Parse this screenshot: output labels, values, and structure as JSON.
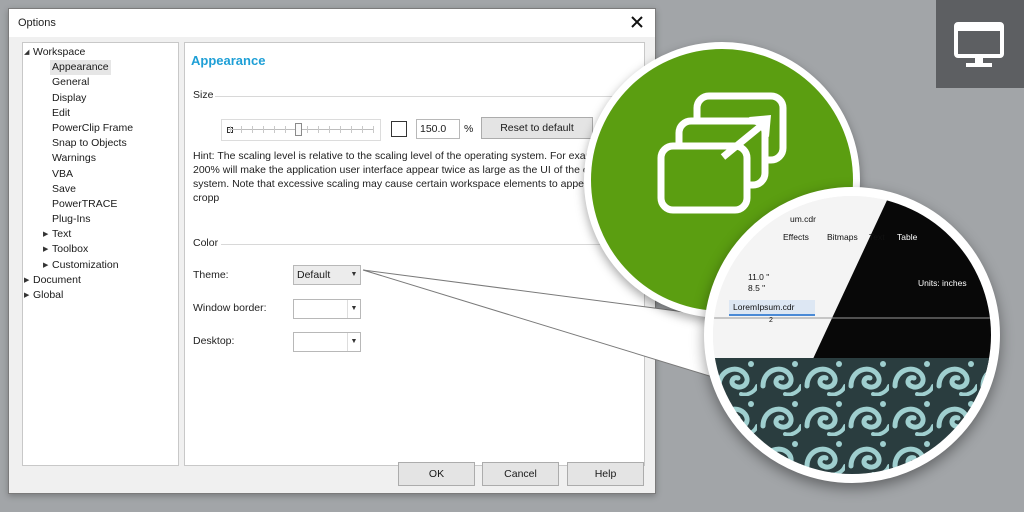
{
  "dialog": {
    "title": "Options",
    "tree": [
      {
        "label": "Workspace",
        "level": 0,
        "arrow": "expanded"
      },
      {
        "label": "Appearance",
        "level": 1,
        "selected": true
      },
      {
        "label": "General",
        "level": 1
      },
      {
        "label": "Display",
        "level": 1
      },
      {
        "label": "Edit",
        "level": 1
      },
      {
        "label": "PowerClip Frame",
        "level": 1
      },
      {
        "label": "Snap to Objects",
        "level": 1
      },
      {
        "label": "Warnings",
        "level": 1
      },
      {
        "label": "VBA",
        "level": 1
      },
      {
        "label": "Save",
        "level": 1
      },
      {
        "label": "PowerTRACE",
        "level": 1
      },
      {
        "label": "Plug-Ins",
        "level": 1
      },
      {
        "label": "Text",
        "level": 1,
        "arrow": "collapsed"
      },
      {
        "label": "Toolbox",
        "level": 1,
        "arrow": "collapsed"
      },
      {
        "label": "Customization",
        "level": 1,
        "arrow": "collapsed"
      },
      {
        "label": "Document",
        "level": 0,
        "arrow": "collapsed"
      },
      {
        "label": "Global",
        "level": 0,
        "arrow": "collapsed"
      }
    ],
    "panel": {
      "title": "Appearance",
      "size_label": "Size",
      "scale_value": "150.0",
      "scale_unit": "%",
      "scale_level": 0.46,
      "reset_label": "Reset to default",
      "hint": "Hint: The scaling level is relative to the scaling level of the operating system. For exar 200% will make the application user interface appear twice as large as the UI of the oper system. Note that excessive scaling may cause certain workspace elements to appear cropp",
      "color_label": "Color",
      "theme_label": "Theme:",
      "theme_value": "Default",
      "window_border_label": "Window border:",
      "desktop_label": "Desktop:"
    },
    "buttons": {
      "ok": "OK",
      "cancel": "Cancel",
      "help": "Help"
    }
  },
  "zoom": {
    "file_title": "um.cdr",
    "menu": [
      "Effects",
      "Bitmaps",
      "Text",
      "Table"
    ],
    "width_value": "11.0 \"",
    "height_value": "8.5 \"",
    "units_label": "Units:",
    "units_value": "inches",
    "tab_label": "LoremIpsum.cdr",
    "ruler_number": "2"
  },
  "colors": {
    "accent": "#1e9fd6",
    "green": "#5b9e11",
    "badge": "#5d5f62",
    "pattern_bg": "#2a3d3f",
    "pattern_fg": "#9fcfcf"
  },
  "icons": {
    "badge": "monitor-icon",
    "green": "window-stack-icon",
    "close": "close-icon"
  }
}
